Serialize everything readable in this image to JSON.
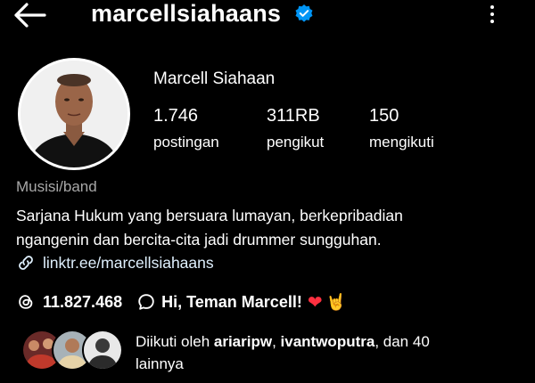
{
  "header": {
    "username": "marcellsiahaans"
  },
  "profile": {
    "full_name": "Marcell Siahaan",
    "stats": [
      {
        "value": "1.746",
        "label": "postingan"
      },
      {
        "value": "311RB",
        "label": "pengikut"
      },
      {
        "value": "150",
        "label": "mengikuti"
      }
    ],
    "category": "Musisi/band",
    "bio_line1": "Sarjana Hukum yang bersuara lumayan, berkepribadian",
    "bio_line2": "ngangenin dan bercita-cita jadi drummer sungguhan.",
    "link": "linktr.ee/marcellsiahaans"
  },
  "threads": {
    "count": "11.827.468",
    "greeting": "Hi, Teman Marcell!"
  },
  "followed_by": {
    "prefix": "Diikuti oleh ",
    "user1": "ariaripw",
    "sep": ", ",
    "user2": "ivantwoputra",
    "suffix_line1": ", dan 40",
    "suffix_line2": "lainnya"
  },
  "colors": {
    "background": "#000000",
    "verified_badge": "#0095f6",
    "link": "#e0f1ff",
    "muted": "#a8a8a8",
    "heart": "#ff3040"
  },
  "icons": [
    "back-arrow-icon",
    "verified-badge-icon",
    "more-options-icon",
    "link-icon",
    "threads-icon",
    "chat-bubble-icon",
    "heart-emoji",
    "rock-hand-emoji"
  ]
}
